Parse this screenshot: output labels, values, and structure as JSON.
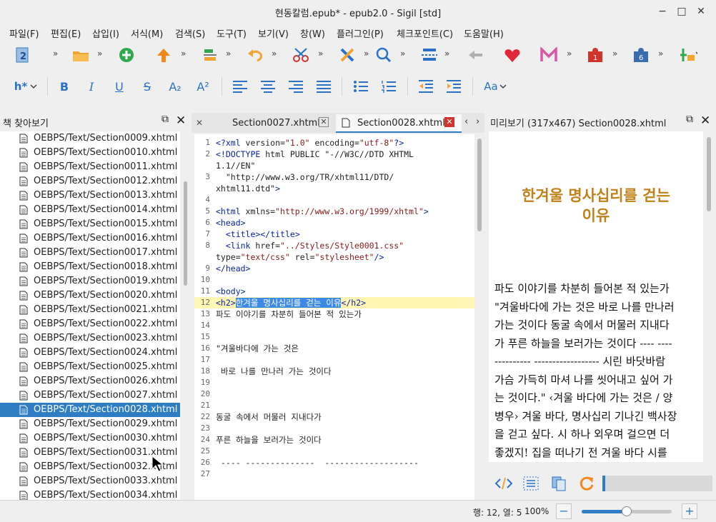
{
  "window": {
    "title": "현동칼럼.epub* - epub2.0 - Sigil [std]",
    "controls": {
      "minimize": "−",
      "maximize": "□",
      "close": "✕"
    }
  },
  "menubar": {
    "items": [
      "파일(F)",
      "편집(E)",
      "삽입(I)",
      "서식(M)",
      "검색(S)",
      "도구(T)",
      "보기(V)",
      "창(W)",
      "플러그인(P)",
      "체크포인트(C)",
      "도움말(H)"
    ]
  },
  "toolbar_main": {
    "more": "»",
    "icons": [
      "page-count-icon",
      "open-folder-icon",
      "add-icon",
      "upload-icon",
      "split-icon",
      "undo-icon",
      "cut-icon",
      "x-tool-icon",
      "search-icon",
      "split-section-icon",
      "back-icon",
      "heart-icon",
      "m-logo-icon",
      "plugin-1-icon",
      "plugin-6-icon",
      "plugin-a-icon"
    ],
    "badges": {
      "page": "2",
      "plugin1": "1",
      "plugin6": "6"
    }
  },
  "toolbar_format": {
    "heading": "h*",
    "bold": "B",
    "italic": "I",
    "underline": "U",
    "strike": "S",
    "subscript": "A₂",
    "superscript": "A²",
    "case": "Aa"
  },
  "book_browser": {
    "title": "책 찾아보기",
    "files": [
      "OEBPS/Text/Section0009.xhtml",
      "OEBPS/Text/Section0010.xhtml",
      "OEBPS/Text/Section0011.xhtml",
      "OEBPS/Text/Section0012.xhtml",
      "OEBPS/Text/Section0013.xhtml",
      "OEBPS/Text/Section0014.xhtml",
      "OEBPS/Text/Section0015.xhtml",
      "OEBPS/Text/Section0016.xhtml",
      "OEBPS/Text/Section0017.xhtml",
      "OEBPS/Text/Section0018.xhtml",
      "OEBPS/Text/Section0019.xhtml",
      "OEBPS/Text/Section0020.xhtml",
      "OEBPS/Text/Section0021.xhtml",
      "OEBPS/Text/Section0022.xhtml",
      "OEBPS/Text/Section0023.xhtml",
      "OEBPS/Text/Section0024.xhtml",
      "OEBPS/Text/Section0025.xhtml",
      "OEBPS/Text/Section0026.xhtml",
      "OEBPS/Text/Section0027.xhtml",
      "OEBPS/Text/Section0028.xhtml",
      "OEBPS/Text/Section0029.xhtml",
      "OEBPS/Text/Section0030.xhtml",
      "OEBPS/Text/Section0031.xhtml",
      "OEBPS/Text/Section0032.xhtml",
      "OEBPS/Text/Section0033.xhtml",
      "OEBPS/Text/Section0034.xhtml"
    ],
    "selected": "OEBPS/Text/Section0028.xhtml"
  },
  "editor": {
    "tabs": [
      {
        "label": "Section0027.xhtml",
        "active": false
      },
      {
        "label": "Section0028.xhtml",
        "active": true
      }
    ],
    "lines": [
      {
        "n": "1",
        "text": "<?xml version=\"1.0\" encoding=\"utf-8\"?>"
      },
      {
        "n": "2",
        "text": "<!DOCTYPE html PUBLIC \"-//W3C//DTD XHTML"
      },
      {
        "n": "",
        "text": "1.1//EN\""
      },
      {
        "n": "3",
        "text": "  \"http://www.w3.org/TR/xhtml11/DTD/"
      },
      {
        "n": "",
        "text": "xhtml11.dtd\">"
      },
      {
        "n": "4",
        "text": ""
      },
      {
        "n": "5",
        "text": "<html xmlns=\"http://www.w3.org/1999/xhtml\">"
      },
      {
        "n": "6",
        "text": "<head>"
      },
      {
        "n": "7",
        "text": "  <title></title>"
      },
      {
        "n": "8",
        "text": "  <link href=\"../Styles/Style0001.css\""
      },
      {
        "n": "",
        "text": "type=\"text/css\" rel=\"stylesheet\"/>"
      },
      {
        "n": "9",
        "text": "</head>"
      },
      {
        "n": "10",
        "text": ""
      },
      {
        "n": "11",
        "text": "<body>"
      },
      {
        "n": "12",
        "text": "<h2>한겨울 명사십리를 걷는 이유</h2>"
      },
      {
        "n": "13",
        "text": "파도 이야기를 차분히 들어본 적 있는가"
      },
      {
        "n": "14",
        "text": ""
      },
      {
        "n": "15",
        "text": ""
      },
      {
        "n": "16",
        "text": "\"겨울바다에 가는 것은"
      },
      {
        "n": "17",
        "text": ""
      },
      {
        "n": "18",
        "text": " 바로 나를 만나러 가는 것이다"
      },
      {
        "n": "19",
        "text": ""
      },
      {
        "n": "20",
        "text": ""
      },
      {
        "n": "21",
        "text": ""
      },
      {
        "n": "22",
        "text": "동굴 속에서 머물러 지내다가"
      },
      {
        "n": "23",
        "text": ""
      },
      {
        "n": "24",
        "text": "푸른 하늘을 보러가는 것이다"
      },
      {
        "n": "25",
        "text": ""
      },
      {
        "n": "26",
        "text": " ---- --------------  -------------------"
      },
      {
        "n": "27",
        "text": ""
      }
    ],
    "h2_open": "<h2>",
    "h2_selected": "한겨울 명사십리를 걷는 이유",
    "h2_close": "</h2>"
  },
  "preview": {
    "title": "미리보기 (317x467) Section0028.xhtml",
    "heading_line1": "한겨울 명사십리를 걷는",
    "heading_line2": "이유",
    "paragraph_lines": [
      "파도 이야기를 차분히 들어본 적 있는가",
      "\"겨울바다에 가는 것은 바로 나를 만나러",
      "가는 것이다 동굴 속에서 머물러 지내다",
      "가 푸른 하늘을 보러가는 것이다 ---- ----",
      "---------- ------------------ 시린 바닷바람",
      "가슴 가득히 마셔 나를 씻어내고 싶어 가",
      "는 것이다.\" ‹겨울 바다에 가는 것은 / 양",
      "병우› 겨울 바다, 명사십리 기나긴 백사장",
      "을 걷고 싶다. 시 하나 외우며 걸으면 더",
      "좋겠지! 집을 떠나기 전 겨울 바다 시를"
    ]
  },
  "statusbar": {
    "position": "행: 12, 열: 5",
    "zoom": "100%",
    "zoom_out": "−",
    "zoom_in": "+",
    "zoom_level": 0.5
  },
  "colors": {
    "accent": "#2f7dc2",
    "heading_preview": "#c0811a",
    "highlight_line": "#fff7b3"
  }
}
